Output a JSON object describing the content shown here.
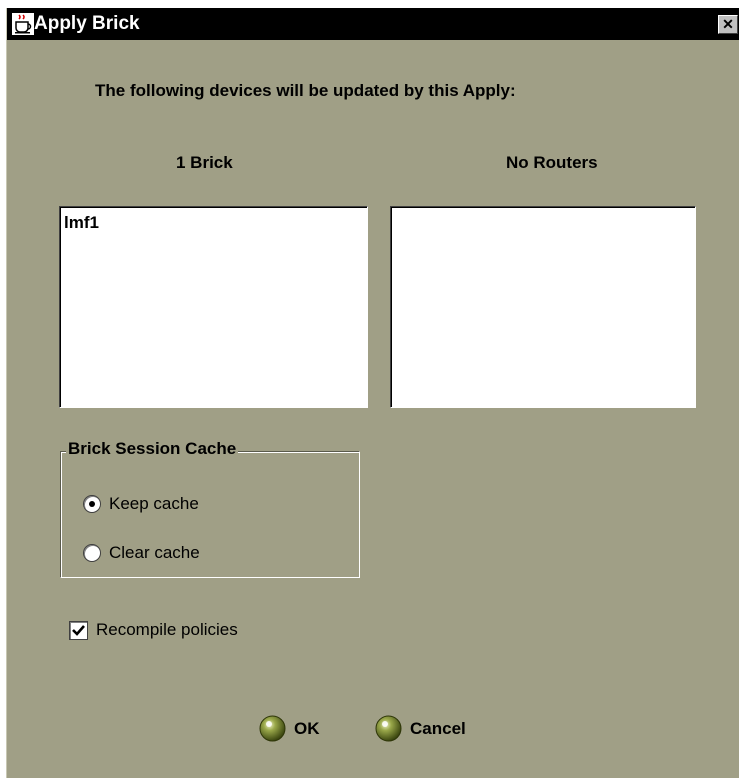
{
  "window": {
    "title": "Apply Brick",
    "close_glyph": "✕"
  },
  "heading": "The following devices will be updated by this Apply:",
  "columns": [
    {
      "label": "1 Brick",
      "items": [
        "lmf1"
      ]
    },
    {
      "label": "No Routers",
      "items": []
    }
  ],
  "session_cache": {
    "legend": "Brick Session Cache",
    "options": [
      {
        "label": "Keep cache",
        "selected": true
      },
      {
        "label": "Clear cache",
        "selected": false
      }
    ]
  },
  "recompile": {
    "label": "Recompile policies",
    "checked": true
  },
  "buttons": {
    "ok": "OK",
    "cancel": "Cancel"
  },
  "colors": {
    "background": "#a09f86",
    "titlebar": "#000000",
    "button_orb": "#5b6a1c"
  },
  "icons": {
    "app": "java-cup-icon",
    "close": "close-icon",
    "ok": "orb-button-icon",
    "cancel": "orb-button-icon"
  }
}
